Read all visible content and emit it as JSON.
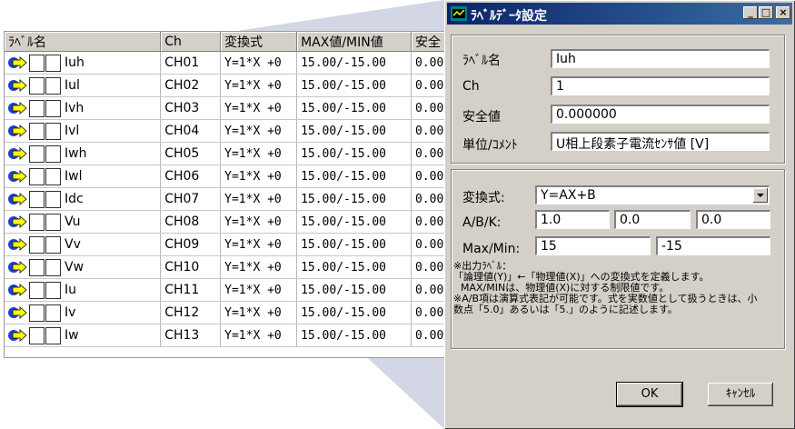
{
  "table": {
    "headers": [
      "ﾗﾍﾞﾙ名",
      "Ch",
      "変換式",
      "MAX値/MIN値",
      "安全"
    ],
    "rows": [
      {
        "label": "Iuh",
        "ch": "CH01",
        "formula": "Y=1*X +0",
        "maxmin": "15.00/-15.00",
        "safe": "0.00"
      },
      {
        "label": "Iul",
        "ch": "CH02",
        "formula": "Y=1*X +0",
        "maxmin": "15.00/-15.00",
        "safe": "0.00"
      },
      {
        "label": "Ivh",
        "ch": "CH03",
        "formula": "Y=1*X +0",
        "maxmin": "15.00/-15.00",
        "safe": "0.00"
      },
      {
        "label": "Ivl",
        "ch": "CH04",
        "formula": "Y=1*X +0",
        "maxmin": "15.00/-15.00",
        "safe": "0.00"
      },
      {
        "label": "Iwh",
        "ch": "CH05",
        "formula": "Y=1*X +0",
        "maxmin": "15.00/-15.00",
        "safe": "0.00"
      },
      {
        "label": "Iwl",
        "ch": "CH06",
        "formula": "Y=1*X +0",
        "maxmin": "15.00/-15.00",
        "safe": "0.00"
      },
      {
        "label": "Idc",
        "ch": "CH07",
        "formula": "Y=1*X +0",
        "maxmin": "15.00/-15.00",
        "safe": "0.00"
      },
      {
        "label": "Vu",
        "ch": "CH08",
        "formula": "Y=1*X +0",
        "maxmin": "15.00/-15.00",
        "safe": "0.00"
      },
      {
        "label": "Vv",
        "ch": "CH09",
        "formula": "Y=1*X +0",
        "maxmin": "15.00/-15.00",
        "safe": "0.00"
      },
      {
        "label": "Vw",
        "ch": "CH10",
        "formula": "Y=1*X +0",
        "maxmin": "15.00/-15.00",
        "safe": "0.00"
      },
      {
        "label": "Iu",
        "ch": "CH11",
        "formula": "Y=1*X +0",
        "maxmin": "15.00/-15.00",
        "safe": "0.00"
      },
      {
        "label": "Iv",
        "ch": "CH12",
        "formula": "Y=1*X +0",
        "maxmin": "15.00/-15.00",
        "safe": "0.00"
      },
      {
        "label": "Iw",
        "ch": "CH13",
        "formula": "Y=1*X +0",
        "maxmin": "15.00/-15.00",
        "safe": "0.00"
      }
    ],
    "row_icon": "arrow-icon"
  },
  "dialog": {
    "title": "ﾗﾍﾞﾙﾃﾞｰﾀ設定",
    "title_icon": "app-icon",
    "controls": {
      "minimize": "_",
      "maximize": "□",
      "close": "×"
    },
    "label_name": {
      "label": "ﾗﾍﾞﾙ名",
      "value": "Iuh"
    },
    "ch": {
      "label": "Ch",
      "value": "1"
    },
    "safe_value": {
      "label": "安全値",
      "value": "0.000000"
    },
    "unit_comment": {
      "label": "単位/ｺﾒﾝﾄ",
      "value": "U相上段素子電流ｾﾝｻ値 [V]"
    },
    "formula": {
      "label": "変換式:",
      "value": "Y=AX+B"
    },
    "abk": {
      "label": "A/B/K:",
      "a": "1.0",
      "b": "0.0",
      "k": "0.0"
    },
    "maxmin": {
      "label": "Max/Min:",
      "max": "15",
      "min": "-15"
    },
    "note": [
      "※出力ﾗﾍﾞﾙ：",
      "「論理値(Y)」←「物理値(X)」への変換式を定義します。",
      "MAX/MINは、物理値(X)に対する制限値です。",
      "※A/B項は演算式表記が可能です。式を実数値として扱うときは、小",
      "数点「5.0」あるいは「5.」のように記述します。"
    ],
    "ok": "OK",
    "cancel": "ｷｬﾝｾﾙ"
  },
  "colors": {
    "titlebar": "#0a246a",
    "wedge": "#c8cde0",
    "arrow_icon": "#2040d0"
  }
}
